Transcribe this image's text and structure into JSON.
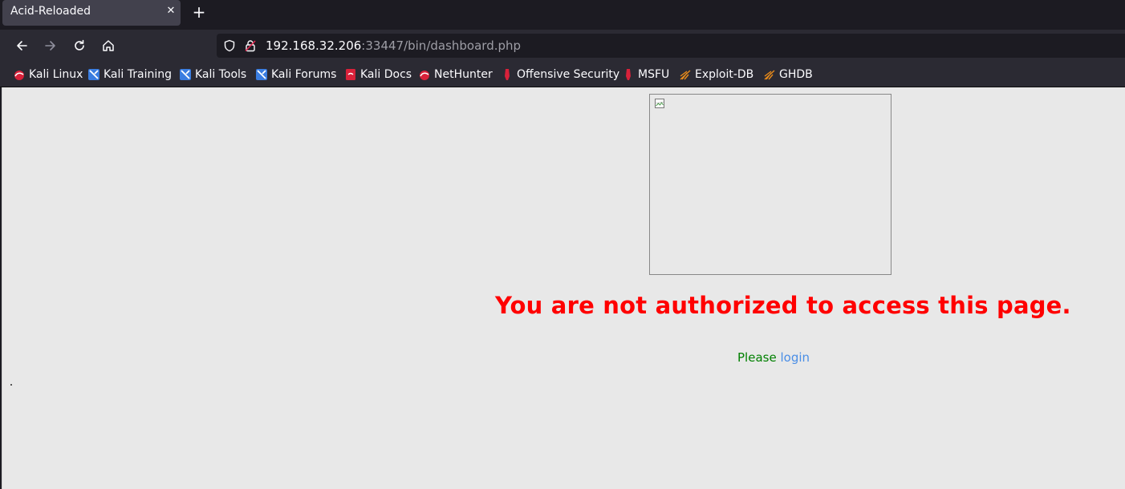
{
  "browser": {
    "tab": {
      "title": "Acid-Reloaded",
      "close_glyph": "✕"
    },
    "new_tab_glyph": "+",
    "url": {
      "host": "192.168.32.206",
      "rest": ":33447/bin/dashboard.php"
    },
    "bookmarks": [
      {
        "label": "Kali Linux",
        "icon": "kali-linux-icon"
      },
      {
        "label": "Kali Training",
        "icon": "kali-training-icon"
      },
      {
        "label": "Kali Tools",
        "icon": "kali-tools-icon"
      },
      {
        "label": "Kali Forums",
        "icon": "kali-forums-icon"
      },
      {
        "label": "Kali Docs",
        "icon": "kali-docs-icon"
      },
      {
        "label": "NetHunter",
        "icon": "nethunter-icon"
      },
      {
        "label": "Offensive Security",
        "icon": "offsec-icon"
      },
      {
        "label": "MSFU",
        "icon": "msfu-icon"
      },
      {
        "label": "Exploit-DB",
        "icon": "exploit-db-icon"
      },
      {
        "label": "GHDB",
        "icon": "ghdb-icon"
      }
    ]
  },
  "page": {
    "heading": "You are not authorized to access this page.",
    "please_text": "Please",
    "login_link": "login",
    "dot": "."
  },
  "colors": {
    "heading": "#ff0000",
    "please": "#008000",
    "link": "#4a8ee6",
    "page_bg": "#e8e8e8",
    "chrome_bg": "#2b2a33"
  }
}
